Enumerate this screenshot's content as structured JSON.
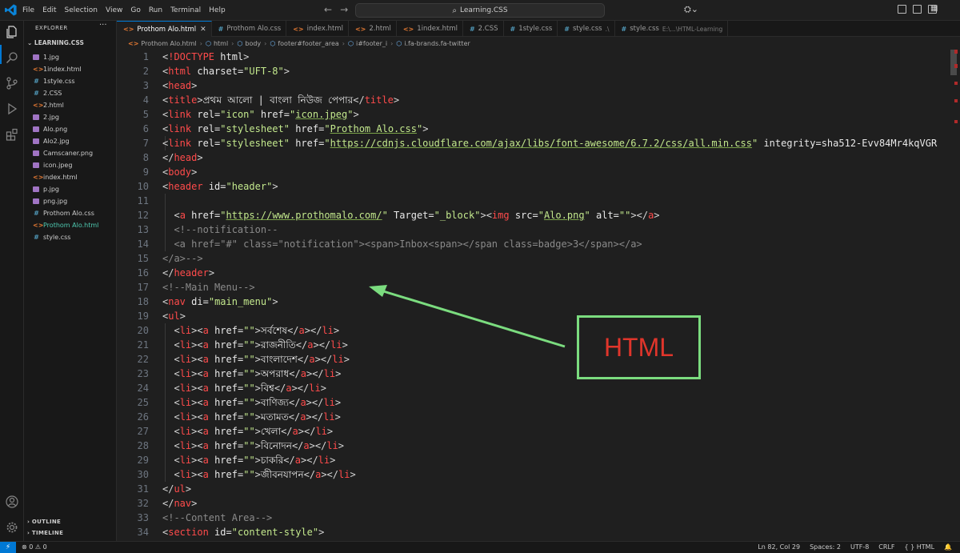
{
  "titlebar": {
    "menus": [
      "File",
      "Edit",
      "Selection",
      "View",
      "Go",
      "Run",
      "Terminal",
      "Help"
    ],
    "command_center": "Learning.CSS"
  },
  "sidebar": {
    "title": "EXPLORER",
    "folder": "LEARNING.CSS",
    "files": [
      {
        "name": "1.jpg",
        "type": "img"
      },
      {
        "name": "1index.html",
        "type": "html"
      },
      {
        "name": "1style.css",
        "type": "css"
      },
      {
        "name": "2.CSS",
        "type": "css"
      },
      {
        "name": "2.html",
        "type": "html"
      },
      {
        "name": "2.jpg",
        "type": "img"
      },
      {
        "name": "Alo.png",
        "type": "img"
      },
      {
        "name": "Alo2.jpg",
        "type": "img"
      },
      {
        "name": "Camscaner.png",
        "type": "img"
      },
      {
        "name": "icon.jpeg",
        "type": "img"
      },
      {
        "name": "index.html",
        "type": "html"
      },
      {
        "name": "p.jpg",
        "type": "img"
      },
      {
        "name": "png.jpg",
        "type": "img"
      },
      {
        "name": "Prothom Alo.css",
        "type": "css"
      },
      {
        "name": "Prothom Alo.html",
        "type": "html",
        "active": true
      },
      {
        "name": "style.css",
        "type": "css"
      }
    ],
    "outline": "OUTLINE",
    "timeline": "TIMELINE"
  },
  "tabs": [
    {
      "label": "Prothom Alo.html",
      "type": "html",
      "active": true
    },
    {
      "label": "Prothom Alo.css",
      "type": "css"
    },
    {
      "label": "index.html",
      "type": "html"
    },
    {
      "label": "2.html",
      "type": "html"
    },
    {
      "label": "1index.html",
      "type": "html"
    },
    {
      "label": "2.CSS",
      "type": "css"
    },
    {
      "label": "1style.css",
      "type": "css"
    },
    {
      "label": "style.css",
      "type": "css",
      "desc": ".\\"
    },
    {
      "label": "style.css",
      "type": "css",
      "desc": "E:\\...\\HTML-Learning"
    }
  ],
  "breadcrumbs": [
    "Prothom Alo.html",
    "html",
    "body",
    "footer#footer_area",
    "i#footer_i",
    "i.fa-brands.fa-twitter"
  ],
  "code_lines": [
    {
      "n": "1",
      "text": "<!DOCTYPE html>"
    },
    {
      "n": "2",
      "text": "<html charset=\"UFT-8\">"
    },
    {
      "n": "3",
      "text": "<head>"
    },
    {
      "n": "4",
      "text": "<title>প্রথম আলো | বাংলা নিউজ পেপার</title>"
    },
    {
      "n": "5",
      "text": "<link rel=\"icon\" href=\"icon.jpeg\">"
    },
    {
      "n": "6",
      "text": "<link rel=\"stylesheet\" href=\"Prothom Alo.css\">"
    },
    {
      "n": "7",
      "text": "<link rel=\"stylesheet\" href=\"https://cdnjs.cloudflare.com/ajax/libs/font-awesome/6.7.2/css/all.min.css\" integrity=\"sha512-Evv84Mr4kqVGR"
    },
    {
      "n": "8",
      "text": "</head>"
    },
    {
      "n": "9",
      "text": "<body>"
    },
    {
      "n": "10",
      "text": "<header id=\"header\">"
    },
    {
      "n": "11",
      "text": ""
    },
    {
      "n": "12",
      "text": "  <a href=\"https://www.prothomalo.com/\" Target=\"_block\"><img src=\"Alo.png\" alt=\"\"></a>"
    },
    {
      "n": "13",
      "text": "  <!--notification--"
    },
    {
      "n": "14",
      "text": "  <a href=\"#\" class=\"notification\"><span>Inbox<span></span class=badge>3</span></a>"
    },
    {
      "n": "15",
      "text": "</a>-->"
    },
    {
      "n": "16",
      "text": "</header>"
    },
    {
      "n": "17",
      "text": "<!--Main Menu-->"
    },
    {
      "n": "18",
      "text": "<nav di=\"main_menu\">"
    },
    {
      "n": "19",
      "text": "<ul>"
    },
    {
      "n": "20",
      "text": "  <li><a href=\"\">সর্বশেষ</a></li>"
    },
    {
      "n": "21",
      "text": "  <li><a href=\"\">রাজনীতি</a></li>"
    },
    {
      "n": "22",
      "text": "  <li><a href=\"\">বাংলাদেশ</a></li>"
    },
    {
      "n": "23",
      "text": "  <li><a href=\"\">অপরাধ</a></li>"
    },
    {
      "n": "24",
      "text": "  <li><a href=\"\">বিশ্ব</a></li>"
    },
    {
      "n": "25",
      "text": "  <li><a href=\"\">বাণিজ্য</a></li>"
    },
    {
      "n": "26",
      "text": "  <li><a href=\"\">মতামত</a></li>"
    },
    {
      "n": "27",
      "text": "  <li><a href=\"\">খেলা</a></li>"
    },
    {
      "n": "28",
      "text": "  <li><a href=\"\">বিনোদন</a></li>"
    },
    {
      "n": "29",
      "text": "  <li><a href=\"\">চাকরি</a></li>"
    },
    {
      "n": "30",
      "text": "  <li><a href=\"\">জীবনযাপন</a></li>"
    },
    {
      "n": "31",
      "text": "</ul>"
    },
    {
      "n": "32",
      "text": "</nav>"
    },
    {
      "n": "33",
      "text": "<!--Content Area-->"
    },
    {
      "n": "34",
      "text": "<section id=\"content-style\">"
    }
  ],
  "annotation": {
    "label": "HTML"
  },
  "statusbar": {
    "problems": "⊗ 0 ⚠ 0",
    "position": "Ln 82, Col 29",
    "spaces": "Spaces: 2",
    "encoding": "UTF-8",
    "eol": "CRLF",
    "language": "{ } HTML"
  },
  "colors": {
    "tag": "#ff4b4b",
    "string": "#c3e88d",
    "comment": "#8a8a8a",
    "accent": "#0078d4",
    "annotation_border": "#7bdc7f",
    "annotation_text": "#e0352b"
  }
}
